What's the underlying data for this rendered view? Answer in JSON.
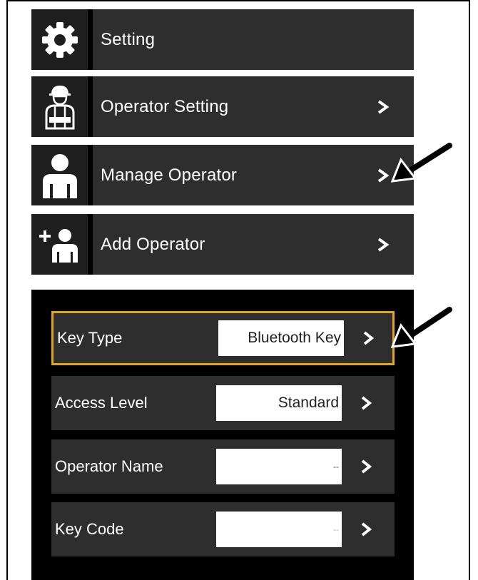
{
  "menu": [
    {
      "label": "Setting",
      "icon": "gear-icon",
      "has_chevron": false
    },
    {
      "label": "Operator Setting",
      "icon": "operator-worker-icon",
      "has_chevron": true
    },
    {
      "label": "Manage Operator",
      "icon": "person-icon",
      "has_chevron": true
    },
    {
      "label": "Add Operator",
      "icon": "add-person-icon",
      "has_chevron": true
    }
  ],
  "fields": [
    {
      "label": "Key Type",
      "value": "Bluetooth Key",
      "selected": true
    },
    {
      "label": "Access Level",
      "value": "Standard",
      "selected": false
    },
    {
      "label": "Operator Name",
      "value": "--",
      "selected": false
    },
    {
      "label": "Key Code",
      "value": "--",
      "selected": false
    }
  ],
  "colors": {
    "selected_border": "#e3a51a",
    "row_bg": "#2e2e2e",
    "panel_bg": "#000000"
  }
}
